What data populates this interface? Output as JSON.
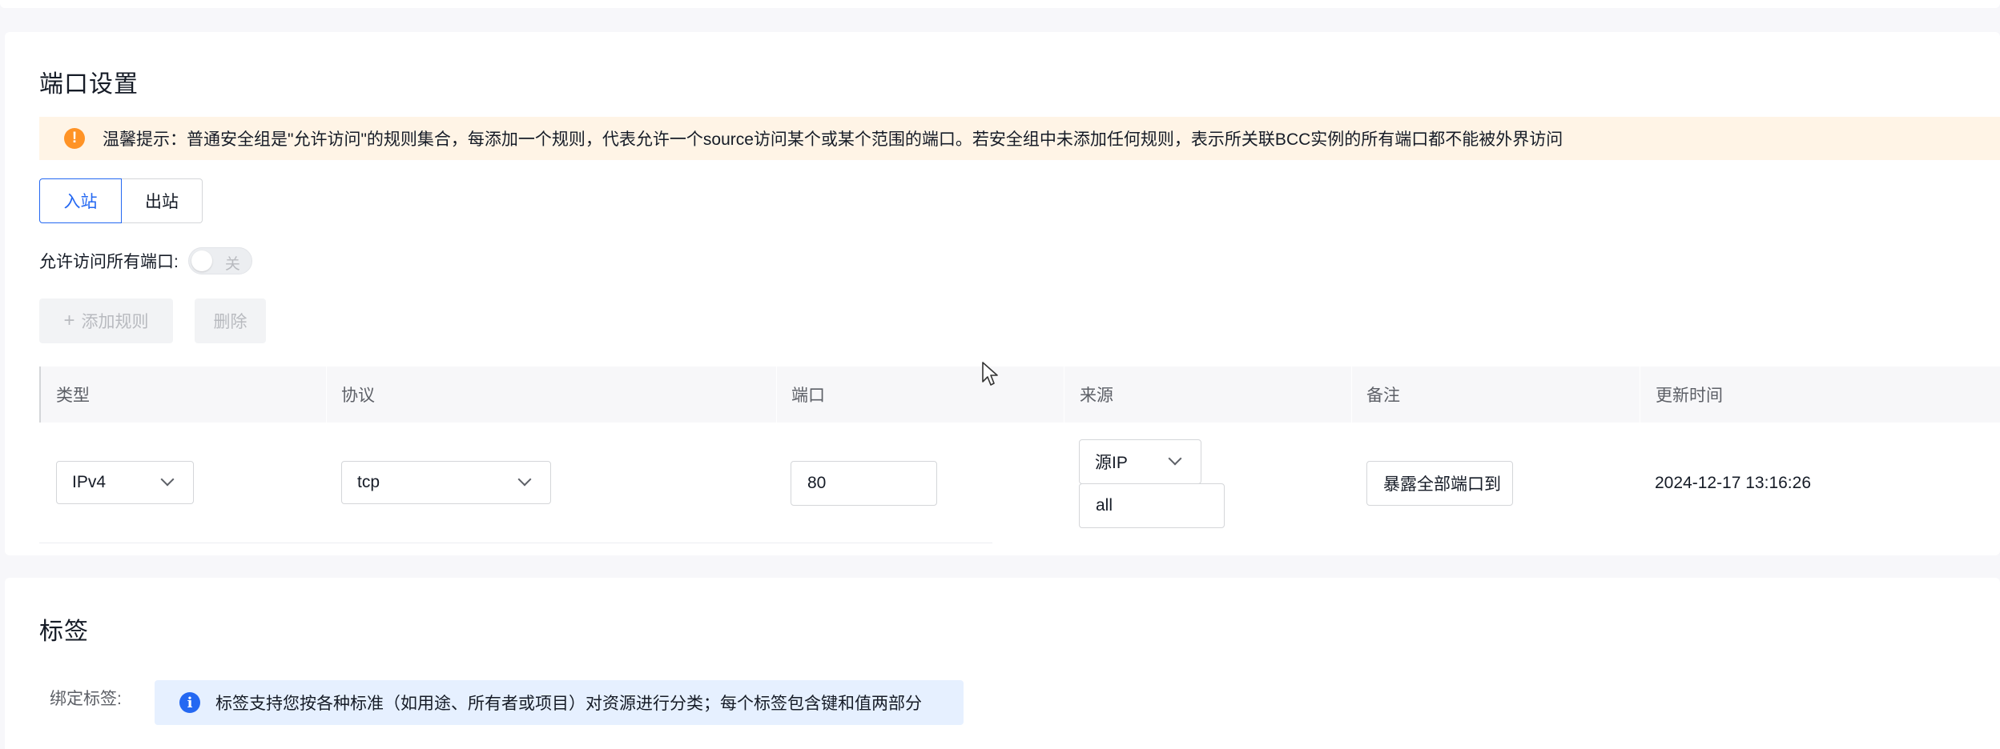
{
  "port_section": {
    "title": "端口设置",
    "notice": "温馨提示：普通安全组是\"允许访问\"的规则集合，每添加一个规则，代表允许一个source访问某个或某个范围的端口。若安全组中未添加任何规则，表示所关联BCC实例的所有端口都不能被外界访问",
    "tabs": {
      "inbound": "入站",
      "outbound": "出站"
    },
    "allow_all_label": "允许访问所有端口:",
    "allow_all_state": "关",
    "add_rule_label": "添加规则",
    "delete_label": "删除",
    "table": {
      "headers": [
        "类型",
        "协议",
        "端口",
        "来源",
        "备注",
        "更新时间"
      ],
      "row": {
        "type": "IPv4",
        "protocol": "tcp",
        "port": "80",
        "source_type": "源IP",
        "source_value": "all",
        "remark": "暴露全部端口到",
        "updated": "2024-12-17 13:16:26"
      }
    }
  },
  "tag_section": {
    "title": "标签",
    "bind_label": "绑定标签:",
    "info": "标签支持您按各种标准（如用途、所有者或项目）对资源进行分类；每个标签包含键和值两部分"
  },
  "colors": {
    "accent": "#2468f2",
    "warning": "#ff9326",
    "warning_bg": "#fff4e6",
    "info_bg": "#e6f0ff"
  }
}
